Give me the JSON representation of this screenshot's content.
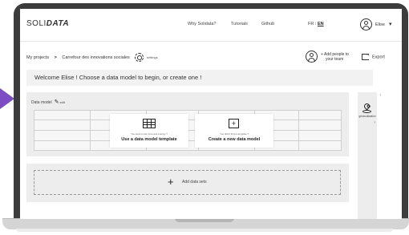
{
  "app": {
    "logo_light": "SOLI",
    "logo_bold": "DATA"
  },
  "nav": {
    "links": [
      "Why Solidata?",
      "Tutorials",
      "Github"
    ],
    "lang_fr": "FR",
    "lang_sep": "/",
    "lang_en": "EN",
    "user_name": "Elise",
    "chevron": "▾"
  },
  "breadcrumb": {
    "root": "My projects",
    "separator": ">",
    "project": "Carrefour des innovations sociales",
    "settings": "settings"
  },
  "add_people": {
    "line1": "+ Add people to",
    "line2": "your team"
  },
  "export": {
    "label": "Export"
  },
  "welcome": {
    "text": "Welcome Elise ! Choose a data model to begin, or create one !"
  },
  "data_model": {
    "label": "Data model",
    "edit": "edit",
    "template_card": {
      "hint": "You want to win time and energy ?",
      "title": "Use a data model template"
    },
    "new_card": {
      "hint": "You didn't find a template ?",
      "plus": "+",
      "title": "Create a new data model"
    }
  },
  "side_panel": {
    "label": "geolocalisation",
    "help": "?"
  },
  "data_sets": {
    "plus": "+",
    "label": "Add data sets"
  },
  "colors": {
    "arrow": "#7b4cc4",
    "panel": "#ededed",
    "bezel": "#3c3c3c"
  },
  "icons": [
    "avatar-icon",
    "gear-icon",
    "export-icon",
    "pencil-icon",
    "table-icon",
    "plus-box-icon",
    "geolocation-icon",
    "plus-icon"
  ]
}
